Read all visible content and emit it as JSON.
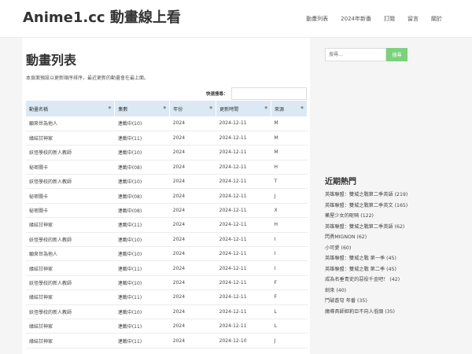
{
  "header": {
    "site_title": "Anime1.cc 動畫線上看",
    "nav": [
      "動畫列表",
      "2024年新番",
      "訂閱",
      "留言",
      "關於"
    ]
  },
  "main": {
    "title": "動畫列表",
    "description": "本頁面預設以更新順序排序，最近更新的動畫會在最上面。",
    "quick_search_label": "快速搜尋：",
    "table": {
      "headers": [
        "動畫名稱",
        "集數",
        "年份",
        "更新時間",
        "來源"
      ],
      "rows": [
        [
          "願來世為他人",
          "連載中(10)",
          "2024",
          "2024-12-11",
          "M"
        ],
        [
          "緣結甘神家",
          "連載中(11)",
          "2024",
          "2024-12-11",
          "M"
        ],
        [
          "妖怪學校的新人教師",
          "連載中(10)",
          "2024",
          "2024-12-11",
          "M"
        ],
        [
          "秘密關卡",
          "連載中(08)",
          "2024",
          "2024-12-11",
          "H"
        ],
        [
          "妖怪學校的新人教師",
          "連載中(10)",
          "2024",
          "2024-12-11",
          "T"
        ],
        [
          "秘密關卡",
          "連載中(08)",
          "2024",
          "2024-12-11",
          "J"
        ],
        [
          "秘密關卡",
          "連載中(08)",
          "2024",
          "2024-12-11",
          "X"
        ],
        [
          "緣結甘神家",
          "連載中(11)",
          "2024",
          "2024-12-11",
          "H"
        ],
        [
          "妖怪學校的新人教師",
          "連載中(10)",
          "2024",
          "2024-12-11",
          "I"
        ],
        [
          "願來世為他人",
          "連載中(10)",
          "2024",
          "2024-12-11",
          "I"
        ],
        [
          "緣結甘神家",
          "連載中(11)",
          "2024",
          "2024-12-11",
          "I"
        ],
        [
          "妖怪學校的新人教師",
          "連載中(10)",
          "2024",
          "2024-12-11",
          "F"
        ],
        [
          "緣結甘神家",
          "連載中(11)",
          "2024",
          "2024-12-11",
          "F"
        ],
        [
          "妖怪學校的新人教師",
          "連載中(10)",
          "2024",
          "2024-12-11",
          "L"
        ],
        [
          "緣結甘神家",
          "連載中(11)",
          "2024",
          "2024-12-11",
          "L"
        ],
        [
          "緣結甘神家",
          "連載中(11)",
          "2024",
          "2024-12-10",
          "J"
        ]
      ]
    }
  },
  "sidebar": {
    "search_placeholder": "搜尋...",
    "search_button": "搜尋",
    "hot_title": "近期熱門",
    "hot_items": [
      "英雄聯盟：雙城之戰第二季英語 (219)",
      "英雄聯盟：雙城之戰第二季英文 (165)",
      "藥屋少女的呢喃 (122)",
      "英雄聯盟：雙城之戰第二季英語 (62)",
      "閃勇MIGNON (62)",
      "小可愛 (60)",
      "英雄聯盟：雙城之戰 第一季 (45)",
      "英雄聯盟：雙城之戰 第二季 (45)",
      "成為名垂青史的惡役千金吧！ (42)",
      "劍來 (40)",
      "鬥破蒼穹 年番 (35)",
      "魔導具師妲莉亞不向人低頭 (35)"
    ]
  },
  "colors": {
    "accent_green": "#7cd27c",
    "table_header_bg": "#dbe9f4",
    "band_bg": "#f5f5f5"
  }
}
